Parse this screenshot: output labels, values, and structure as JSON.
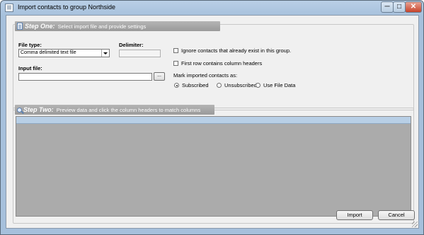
{
  "window": {
    "title": "Import contacts to group Northside",
    "controls": {
      "minimize": "─",
      "maximize": "□",
      "close": "✕"
    }
  },
  "step_one": {
    "heading": "Step One:",
    "subheading": "Select import file and provide settings",
    "icon": "document-icon",
    "file_type_label": "File type:",
    "file_type_value": "Comma delimited text file",
    "delimiter_label": "Delimiter:",
    "delimiter_value": "",
    "input_file_label": "Input file:",
    "input_file_value": "",
    "browse_label": "...",
    "ignore_existing_label": "Ignore contacts that already exist in this group.",
    "ignore_existing_checked": false,
    "first_row_headers_label": "First row contains column headers",
    "first_row_headers_checked": false,
    "mark_as_label": "Mark imported contacts as:",
    "mark_as_options": [
      "Subscribed",
      "Unsubscribed",
      "Use File Data"
    ],
    "mark_as_selected": "Subscribed"
  },
  "step_two": {
    "heading": "Step Two:",
    "subheading": "Preview data and click the column headers to match columns",
    "icon": "magnifier-icon"
  },
  "buttons": {
    "import": "Import",
    "cancel": "Cancel"
  }
}
